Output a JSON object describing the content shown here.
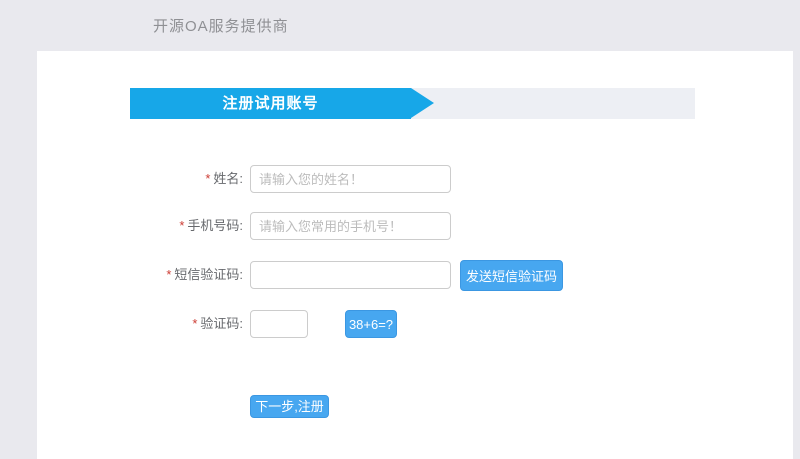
{
  "header": {
    "title": "开源OA服务提供商"
  },
  "banner": {
    "title": "注册试用账号"
  },
  "form": {
    "required_marker": "*",
    "fields": {
      "name": {
        "label": "姓名:",
        "placeholder": "请输入您的姓名！",
        "value": ""
      },
      "phone": {
        "label": "手机号码:",
        "placeholder": "请输入您常用的手机号！",
        "value": ""
      },
      "sms": {
        "label": "短信验证码:",
        "placeholder": "",
        "value": ""
      },
      "captcha": {
        "label": "验证码:",
        "placeholder": "",
        "value": ""
      }
    },
    "buttons": {
      "send_sms": "发送短信验证码",
      "captcha_question": "38+6=?",
      "submit": "下一步,注册"
    }
  },
  "colors": {
    "page_bg": "#e9e9ee",
    "panel_bg": "#ffffff",
    "banner_blue": "#17a7e8",
    "banner_strip_bg": "#edeff4",
    "button_blue": "#47a7f0",
    "label_gray": "#67696d",
    "required_red": "#cc3b33",
    "placeholder_gray": "#bcbcbc"
  }
}
